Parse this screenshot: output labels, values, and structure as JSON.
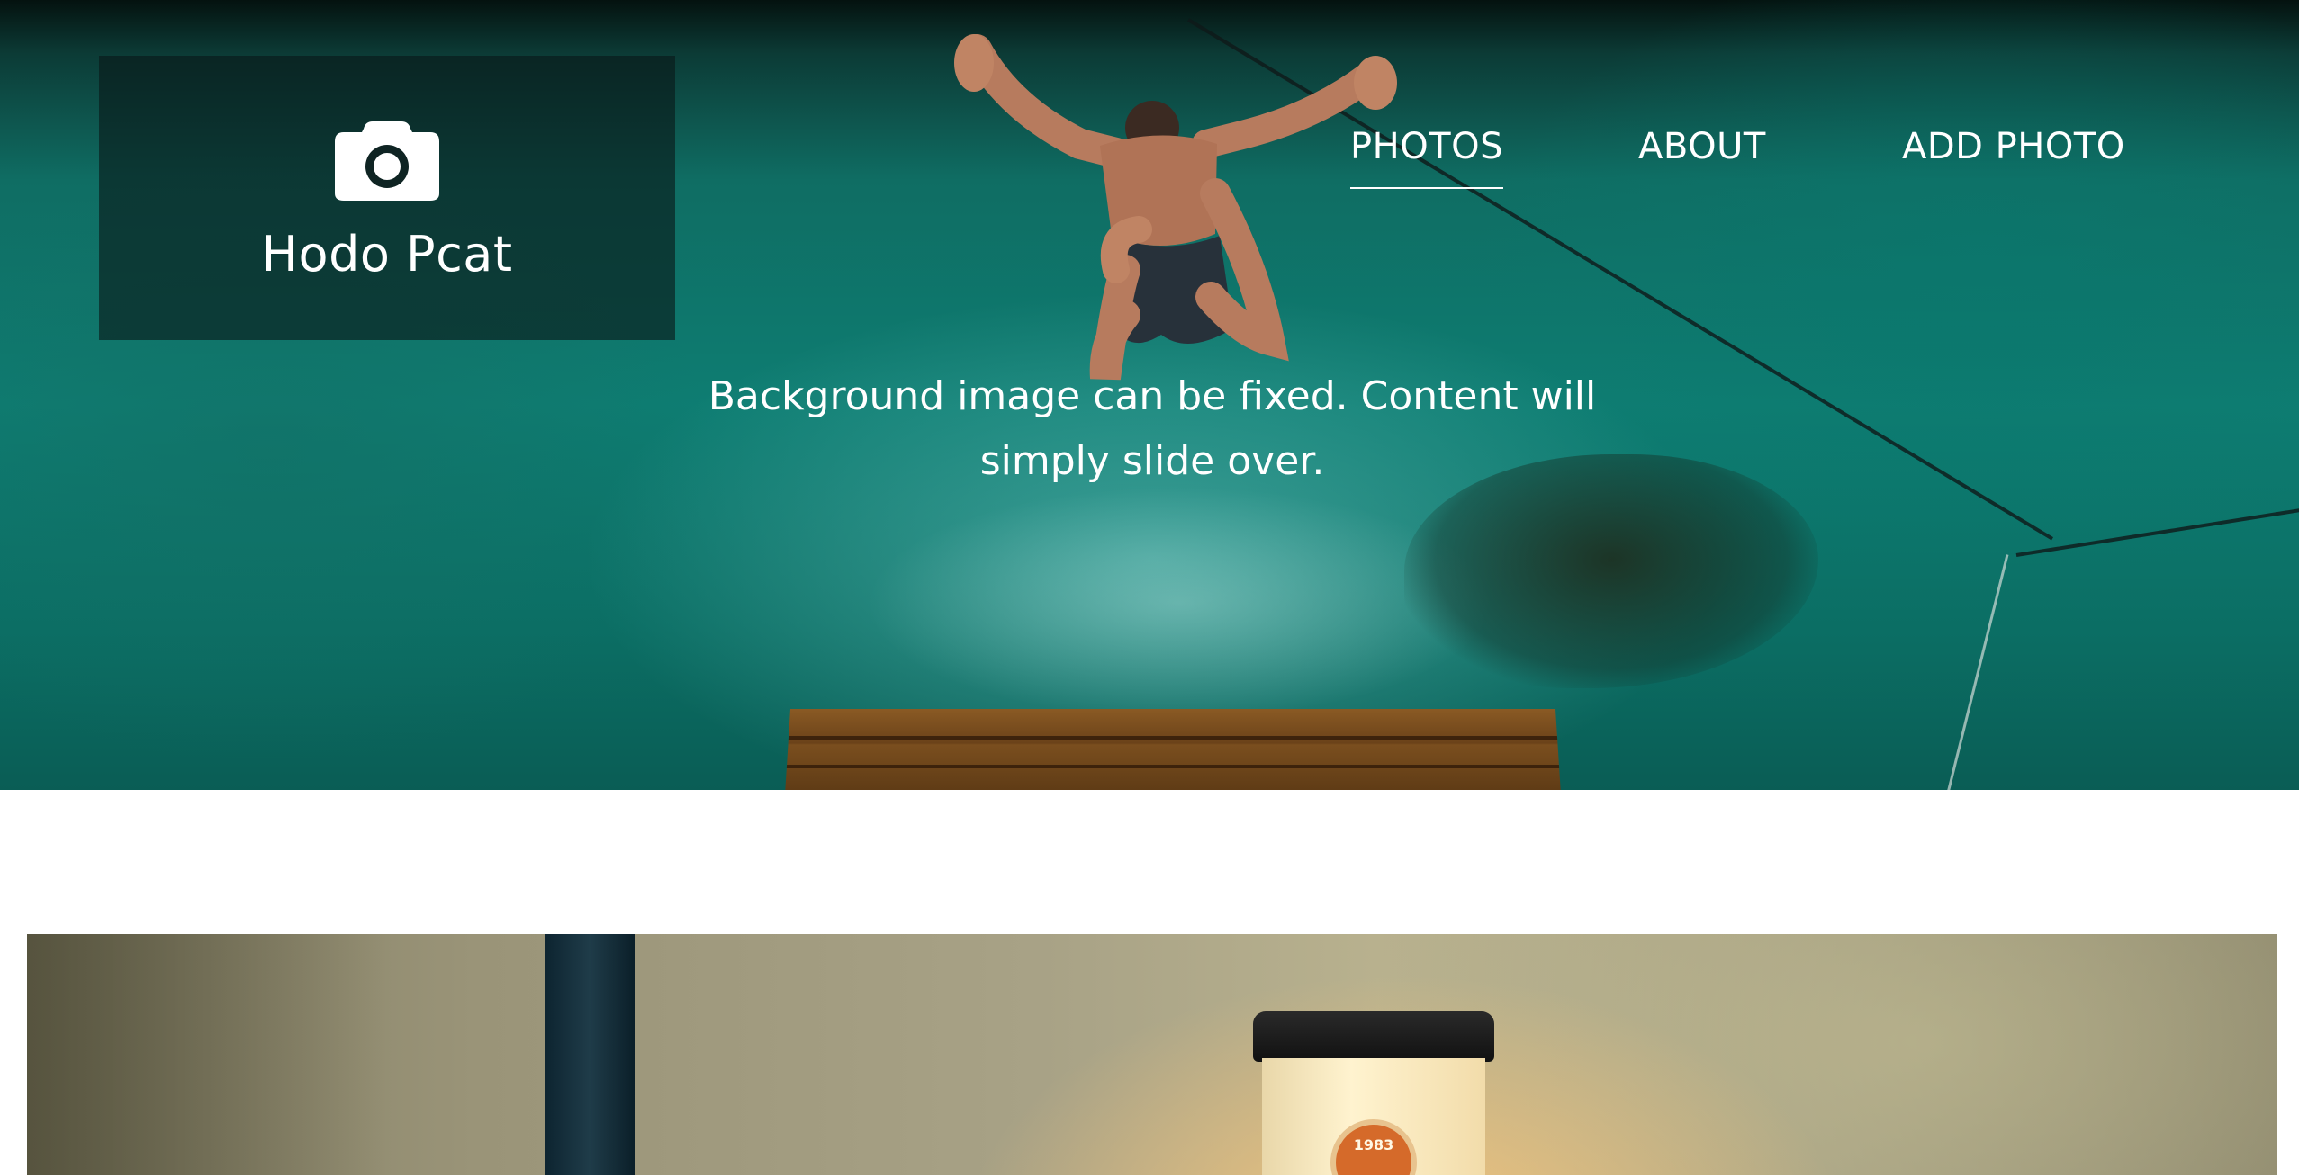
{
  "brand": {
    "name": "Hodo Pcat",
    "icon": "camera-icon"
  },
  "nav": {
    "items": [
      {
        "label": "PHOTOS",
        "active": true
      },
      {
        "label": "ABOUT",
        "active": false
      },
      {
        "label": "ADD PHOTO",
        "active": false
      }
    ]
  },
  "hero": {
    "tagline": "Background image can be fixed. Content will simply slide over."
  },
  "gallery": {
    "cup_text": "1983"
  },
  "colors": {
    "text_on_hero": "#ffffff",
    "page_background": "#ffffff",
    "logo_panel": "#0a1919"
  }
}
